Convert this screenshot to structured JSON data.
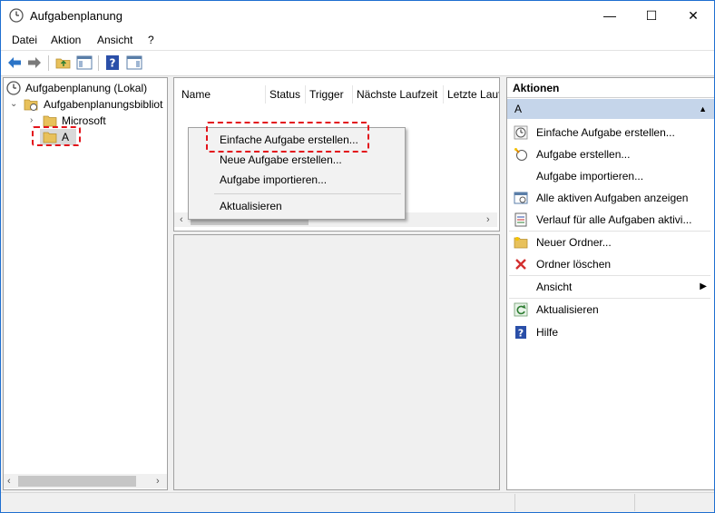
{
  "window": {
    "title": "Aufgabenplanung",
    "icon": "clock-icon",
    "controls": {
      "minimize": "—",
      "maximize": "☐",
      "close": "✕"
    }
  },
  "menu": [
    "Datei",
    "Aktion",
    "Ansicht",
    "?"
  ],
  "toolbar": {
    "icons": [
      "back-arrow-icon",
      "forward-arrow-icon",
      "up-folder-icon",
      "show-hide-console-tree-icon",
      "help-icon",
      "show-hide-action-pane-icon"
    ]
  },
  "tree": {
    "root": "Aufgabenplanung (Lokal)",
    "library": "Aufgabenplanungsbibliot",
    "children": [
      "Microsoft",
      "A"
    ],
    "selected": "A"
  },
  "tasks_list": {
    "columns": [
      "Name",
      "Status",
      "Trigger",
      "Nächste Laufzeit",
      "Letzte Lauf"
    ]
  },
  "context_menu": {
    "items": [
      "Einfache Aufgabe erstellen...",
      "Neue Aufgabe erstellen...",
      "Aufgabe importieren...",
      "Aktualisieren"
    ],
    "highlighted": "Einfache Aufgabe erstellen..."
  },
  "actions": {
    "title": "Aktionen",
    "section": "A",
    "items": [
      {
        "label": "Einfache Aufgabe erstellen...",
        "icon": "wizard-clock-icon"
      },
      {
        "label": "Aufgabe erstellen...",
        "icon": "create-task-icon"
      },
      {
        "label": "Aufgabe importieren...",
        "icon": ""
      },
      {
        "label": "Alle aktiven Aufgaben anzeigen",
        "icon": "running-tasks-icon"
      },
      {
        "label": "Verlauf für alle Aufgaben aktivi...",
        "icon": "history-icon"
      },
      {
        "label": "Neuer Ordner...",
        "icon": "new-folder-icon"
      },
      {
        "label": "Ordner löschen",
        "icon": "delete-x-icon"
      },
      {
        "label": "Ansicht",
        "icon": ""
      },
      {
        "label": "Aktualisieren",
        "icon": "refresh-icon"
      },
      {
        "label": "Hilfe",
        "icon": "help-icon"
      }
    ]
  },
  "colors": {
    "highlight_dashed": "#e3131b",
    "section_bg": "#c5d5ea",
    "window_border": "#1f6fd0"
  }
}
